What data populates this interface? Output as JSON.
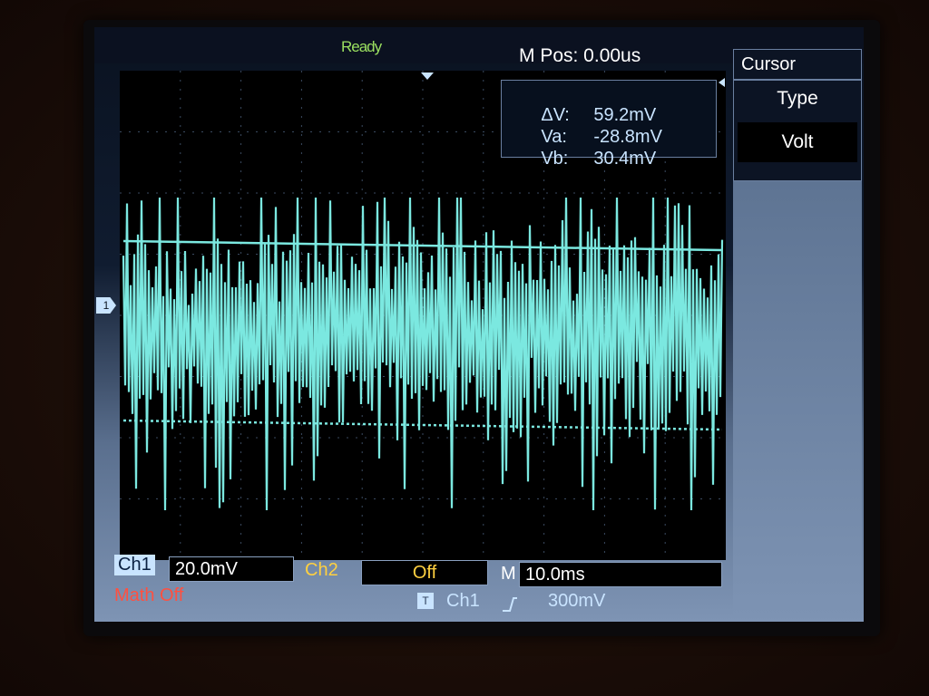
{
  "status": "Ready",
  "mpos": "M Pos: 0.00us",
  "cursor_readout": {
    "delta_label": "ΔV:",
    "delta_value": "59.2mV",
    "va_label": "Va:",
    "va_value": "-28.8mV",
    "vb_label": "Vb:",
    "vb_value": "30.4mV"
  },
  "menu": {
    "title": "Cursor",
    "type_label": "Type",
    "type_value": "Volt"
  },
  "channel_marker": "1",
  "bottom": {
    "ch1_label": "Ch1",
    "ch1_scale": "20.0mV",
    "ch2_label": "Ch2",
    "ch2_value": "Off",
    "time_label": "M",
    "time_value": "10.0ms",
    "math": "Math Off",
    "trigger_icon": "T",
    "trigger_source": "Ch1",
    "trigger_slope_icon": "rising-edge-icon",
    "trigger_level": "300mV"
  },
  "colors": {
    "trace": "#7be8e0",
    "status": "#9be060",
    "ch1": "#c9e4ff",
    "ch2": "#ffd040",
    "math": "#ff5040"
  }
}
